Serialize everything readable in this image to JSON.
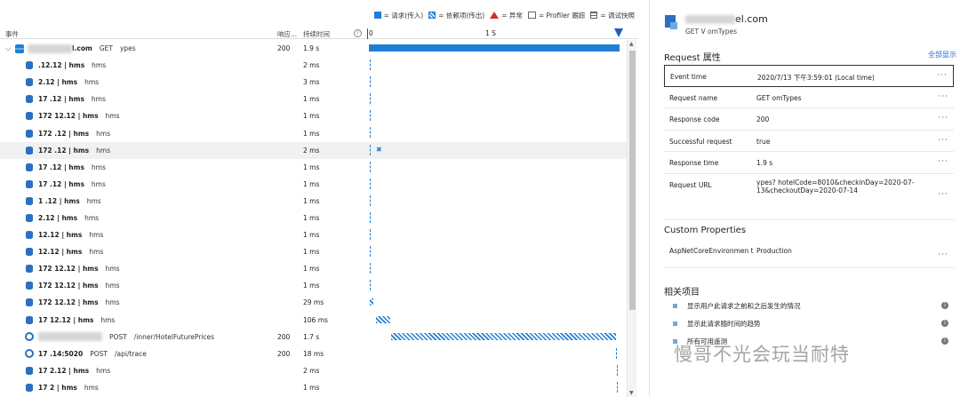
{
  "legend": {
    "request": "= 请求(传入)",
    "dependency": "= 依赖项(传出)",
    "exception": "= 异常",
    "profiler": "= Profiler 跟踪",
    "snapshot": "= 调试快照"
  },
  "columns": {
    "event": "事件",
    "response": "响应...",
    "duration": "持续时间",
    "tick0": "0",
    "tick1": "1 S"
  },
  "rows": [
    {
      "name": "l.com",
      "method": "GET",
      "sub": "ypes",
      "resp": "200",
      "dur": "1.9 s",
      "bar": {
        "type": "solid",
        "start": 0,
        "width": 1.0
      }
    },
    {
      "name": ".12.12 | hms",
      "sub": "hms",
      "resp": "",
      "dur": "2 ms",
      "bar": {
        "type": "tick",
        "start": 0.003
      }
    },
    {
      "name": "2.12 | hms",
      "sub": "hms",
      "resp": "",
      "dur": "3 ms",
      "bar": {
        "type": "tick",
        "start": 0.003
      }
    },
    {
      "name": "17 .12 | hms",
      "sub": "hms",
      "resp": "",
      "dur": "1 ms",
      "bar": {
        "type": "tick",
        "start": 0.004
      }
    },
    {
      "name": "172 12.12 | hms",
      "sub": "hms",
      "resp": "",
      "dur": "1 ms",
      "bar": {
        "type": "tick",
        "start": 0.004
      }
    },
    {
      "name": "172 .12 | hms",
      "sub": "hms",
      "resp": "",
      "dur": "1 ms",
      "bar": {
        "type": "tick",
        "start": 0.004
      }
    },
    {
      "name": "172 .12 | hms",
      "sub": "hms",
      "resp": "",
      "dur": "2 ms",
      "bar": {
        "type": "tick",
        "start": 0.004
      }
    },
    {
      "name": "17 .12 | hms",
      "sub": "hms",
      "resp": "",
      "dur": "1 ms",
      "bar": {
        "type": "tick",
        "start": 0.004
      }
    },
    {
      "name": "17 .12 | hms",
      "sub": "hms",
      "resp": "",
      "dur": "1 ms",
      "bar": {
        "type": "tick",
        "start": 0.004
      }
    },
    {
      "name": "1 .12 | hms",
      "sub": "hms",
      "resp": "",
      "dur": "1 ms",
      "bar": {
        "type": "tick",
        "start": 0.004
      }
    },
    {
      "name": "2.12 | hms",
      "sub": "hms",
      "resp": "",
      "dur": "1 ms",
      "bar": {
        "type": "tick",
        "start": 0.004
      }
    },
    {
      "name": "12.12 | hms",
      "sub": "hms",
      "resp": "",
      "dur": "1 ms",
      "bar": {
        "type": "tick",
        "start": 0.004
      }
    },
    {
      "name": "12.12 | hms",
      "sub": "hms",
      "resp": "",
      "dur": "1 ms",
      "bar": {
        "type": "tick",
        "start": 0.004
      }
    },
    {
      "name": "172 12.12 | hms",
      "sub": "hms",
      "resp": "",
      "dur": "1 ms",
      "bar": {
        "type": "tick",
        "start": 0.004
      }
    },
    {
      "name": "172 12.12 | hms",
      "sub": "hms",
      "resp": "",
      "dur": "1 ms",
      "bar": {
        "type": "tick",
        "start": 0.004
      }
    },
    {
      "name": "172 12.12 | hms",
      "sub": "hms",
      "resp": "",
      "dur": "29 ms",
      "bar": {
        "type": "hatch",
        "start": 0.004,
        "width": 0.015
      }
    },
    {
      "name": "17 12.12 | hms",
      "sub": "hms",
      "resp": "",
      "dur": "106 ms",
      "bar": {
        "type": "hatch",
        "start": 0.03,
        "width": 0.055
      }
    },
    {
      "name": "",
      "method": "POST",
      "sub": "/inner/HotelFuturePrices",
      "resp": "200",
      "dur": "1.7 s",
      "bar": {
        "type": "hatch",
        "start": 0.09,
        "width": 0.895
      }
    },
    {
      "name": "17 .14:5020",
      "method": "POST",
      "sub": "/api/trace",
      "resp": "200",
      "dur": "18 ms",
      "bar": {
        "type": "tick",
        "start": 0.985
      }
    },
    {
      "name": "17 2.12 | hms",
      "sub": "hms",
      "resp": "",
      "dur": "2 ms",
      "bar": {
        "type": "tick",
        "start": 0.99
      }
    },
    {
      "name": "17 2 | hms",
      "sub": "hms",
      "resp": "",
      "dur": "1 ms",
      "bar": {
        "type": "tick",
        "start": 0.99
      }
    }
  ],
  "details": {
    "title": "el.com",
    "subtitle": "GET V omTypes",
    "props_header": "Request 属性",
    "show_all": "全部显示",
    "props": [
      {
        "k": "Event time",
        "v": "2020/7/13 下午3:59:01 (Local time)"
      },
      {
        "k": "Request name",
        "v": "GET omTypes"
      },
      {
        "k": "Response code",
        "v": "200"
      },
      {
        "k": "Successful request",
        "v": "true"
      },
      {
        "k": "Response time",
        "v": "1.9 s"
      },
      {
        "k": "Request URL",
        "v": "ypes?\nhotelCode=8010&checkinDay=2020-07-13&checkoutDay=2020-07-14"
      }
    ],
    "custom_header": "Custom Properties",
    "custom": [
      {
        "k": "AspNetCoreEnvironmen t",
        "v": "Production"
      }
    ],
    "related_header": "相关项目",
    "related": [
      "显示用户此请求之前和之后发生的情况",
      "显示此请求随时间的趋势",
      "所有可用遥测"
    ],
    "watermark": "慢哥不光会玩当耐特"
  }
}
